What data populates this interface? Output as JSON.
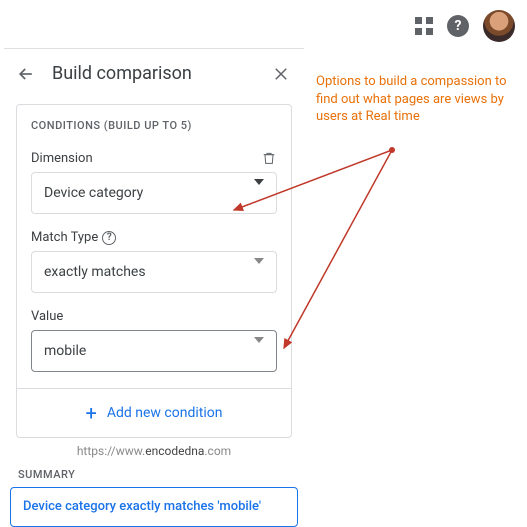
{
  "header": {
    "title": "Build comparison"
  },
  "conditions": {
    "sectionTitle": "CONDITIONS (BUILD UP TO 5)",
    "dimensionLabel": "Dimension",
    "dimensionValue": "Device category",
    "matchTypeLabel": "Match Type",
    "matchTypeValue": "exactly matches",
    "valueLabel": "Value",
    "valueValue": "mobile",
    "addCondition": "Add new condition"
  },
  "watermark": {
    "prefix": "https://www.",
    "bold": "encodedna",
    "suffix": ".com"
  },
  "summary": {
    "label": "SUMMARY",
    "text": "Device category exactly matches 'mobile'"
  },
  "annotation": {
    "text": "Options to build a compassion to find out what pages are views by users at Real time"
  }
}
